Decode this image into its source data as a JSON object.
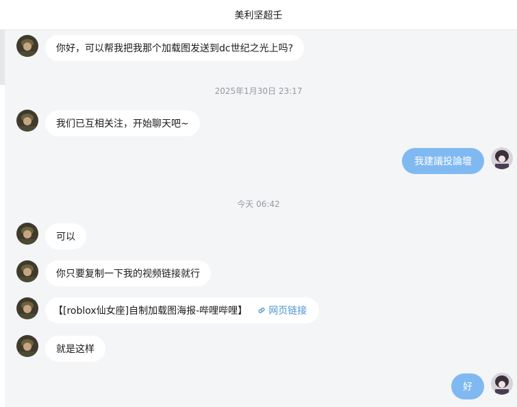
{
  "header": {
    "title": "美利坚超壬"
  },
  "messages": {
    "m1": "你好，可以帮我把我那个加载图发送到dc世纪之光上吗?",
    "t1": "2025年1月30日 23:17",
    "m2": "我们已互相关注，开始聊天吧~",
    "m3": "我建議投論壇",
    "t2": "今天 06:42",
    "m4": "可以",
    "m5": "你只要复制一下我的视频链接就行",
    "m6": "【[roblox仙女座]自制加载图海报-哔哩哔哩】",
    "m6_link": "网页链接",
    "m7": "就是这样",
    "m8": "好"
  },
  "colors": {
    "accent": "#80b9f2",
    "link": "#4c93d3",
    "background": "#f4f5f7"
  },
  "icons": {
    "link": "link-icon"
  }
}
